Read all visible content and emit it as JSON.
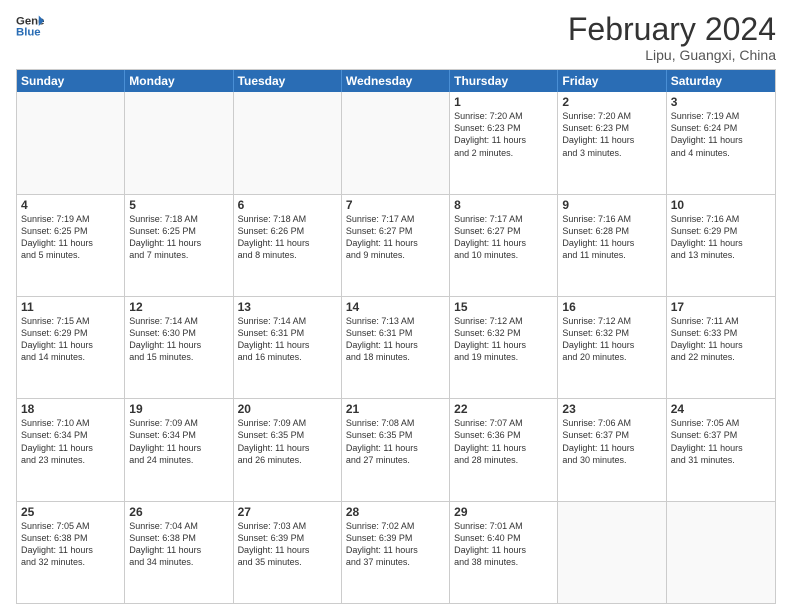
{
  "header": {
    "logo_line1": "General",
    "logo_line2": "Blue",
    "month_title": "February 2024",
    "location": "Lipu, Guangxi, China"
  },
  "weekdays": [
    "Sunday",
    "Monday",
    "Tuesday",
    "Wednesday",
    "Thursday",
    "Friday",
    "Saturday"
  ],
  "rows": [
    [
      {
        "day": "",
        "info": ""
      },
      {
        "day": "",
        "info": ""
      },
      {
        "day": "",
        "info": ""
      },
      {
        "day": "",
        "info": ""
      },
      {
        "day": "1",
        "info": "Sunrise: 7:20 AM\nSunset: 6:23 PM\nDaylight: 11 hours\nand 2 minutes."
      },
      {
        "day": "2",
        "info": "Sunrise: 7:20 AM\nSunset: 6:23 PM\nDaylight: 11 hours\nand 3 minutes."
      },
      {
        "day": "3",
        "info": "Sunrise: 7:19 AM\nSunset: 6:24 PM\nDaylight: 11 hours\nand 4 minutes."
      }
    ],
    [
      {
        "day": "4",
        "info": "Sunrise: 7:19 AM\nSunset: 6:25 PM\nDaylight: 11 hours\nand 5 minutes."
      },
      {
        "day": "5",
        "info": "Sunrise: 7:18 AM\nSunset: 6:25 PM\nDaylight: 11 hours\nand 7 minutes."
      },
      {
        "day": "6",
        "info": "Sunrise: 7:18 AM\nSunset: 6:26 PM\nDaylight: 11 hours\nand 8 minutes."
      },
      {
        "day": "7",
        "info": "Sunrise: 7:17 AM\nSunset: 6:27 PM\nDaylight: 11 hours\nand 9 minutes."
      },
      {
        "day": "8",
        "info": "Sunrise: 7:17 AM\nSunset: 6:27 PM\nDaylight: 11 hours\nand 10 minutes."
      },
      {
        "day": "9",
        "info": "Sunrise: 7:16 AM\nSunset: 6:28 PM\nDaylight: 11 hours\nand 11 minutes."
      },
      {
        "day": "10",
        "info": "Sunrise: 7:16 AM\nSunset: 6:29 PM\nDaylight: 11 hours\nand 13 minutes."
      }
    ],
    [
      {
        "day": "11",
        "info": "Sunrise: 7:15 AM\nSunset: 6:29 PM\nDaylight: 11 hours\nand 14 minutes."
      },
      {
        "day": "12",
        "info": "Sunrise: 7:14 AM\nSunset: 6:30 PM\nDaylight: 11 hours\nand 15 minutes."
      },
      {
        "day": "13",
        "info": "Sunrise: 7:14 AM\nSunset: 6:31 PM\nDaylight: 11 hours\nand 16 minutes."
      },
      {
        "day": "14",
        "info": "Sunrise: 7:13 AM\nSunset: 6:31 PM\nDaylight: 11 hours\nand 18 minutes."
      },
      {
        "day": "15",
        "info": "Sunrise: 7:12 AM\nSunset: 6:32 PM\nDaylight: 11 hours\nand 19 minutes."
      },
      {
        "day": "16",
        "info": "Sunrise: 7:12 AM\nSunset: 6:32 PM\nDaylight: 11 hours\nand 20 minutes."
      },
      {
        "day": "17",
        "info": "Sunrise: 7:11 AM\nSunset: 6:33 PM\nDaylight: 11 hours\nand 22 minutes."
      }
    ],
    [
      {
        "day": "18",
        "info": "Sunrise: 7:10 AM\nSunset: 6:34 PM\nDaylight: 11 hours\nand 23 minutes."
      },
      {
        "day": "19",
        "info": "Sunrise: 7:09 AM\nSunset: 6:34 PM\nDaylight: 11 hours\nand 24 minutes."
      },
      {
        "day": "20",
        "info": "Sunrise: 7:09 AM\nSunset: 6:35 PM\nDaylight: 11 hours\nand 26 minutes."
      },
      {
        "day": "21",
        "info": "Sunrise: 7:08 AM\nSunset: 6:35 PM\nDaylight: 11 hours\nand 27 minutes."
      },
      {
        "day": "22",
        "info": "Sunrise: 7:07 AM\nSunset: 6:36 PM\nDaylight: 11 hours\nand 28 minutes."
      },
      {
        "day": "23",
        "info": "Sunrise: 7:06 AM\nSunset: 6:37 PM\nDaylight: 11 hours\nand 30 minutes."
      },
      {
        "day": "24",
        "info": "Sunrise: 7:05 AM\nSunset: 6:37 PM\nDaylight: 11 hours\nand 31 minutes."
      }
    ],
    [
      {
        "day": "25",
        "info": "Sunrise: 7:05 AM\nSunset: 6:38 PM\nDaylight: 11 hours\nand 32 minutes."
      },
      {
        "day": "26",
        "info": "Sunrise: 7:04 AM\nSunset: 6:38 PM\nDaylight: 11 hours\nand 34 minutes."
      },
      {
        "day": "27",
        "info": "Sunrise: 7:03 AM\nSunset: 6:39 PM\nDaylight: 11 hours\nand 35 minutes."
      },
      {
        "day": "28",
        "info": "Sunrise: 7:02 AM\nSunset: 6:39 PM\nDaylight: 11 hours\nand 37 minutes."
      },
      {
        "day": "29",
        "info": "Sunrise: 7:01 AM\nSunset: 6:40 PM\nDaylight: 11 hours\nand 38 minutes."
      },
      {
        "day": "",
        "info": ""
      },
      {
        "day": "",
        "info": ""
      }
    ]
  ]
}
